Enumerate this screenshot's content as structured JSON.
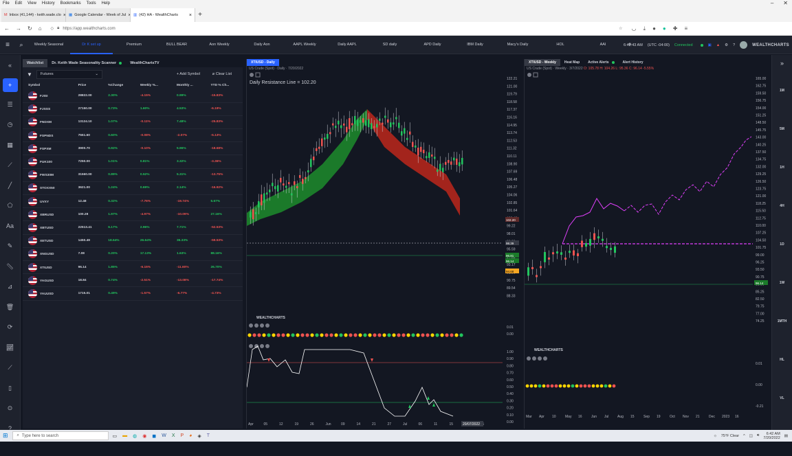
{
  "browser": {
    "menu": [
      "File",
      "Edit",
      "View",
      "History",
      "Bookmarks",
      "Tools",
      "Help"
    ],
    "tabs": [
      {
        "label": "Inbox (41,144) - keith.wade.clo",
        "active": false
      },
      {
        "label": "Google Calendar - Week of Jul",
        "active": false
      },
      {
        "label": "(42) HA - WealthCharts",
        "active": true
      }
    ],
    "url": "https://app.wealthcharts.com"
  },
  "app": {
    "tabs": [
      "Weekly Seasonal",
      "Dr K set up",
      "Premium",
      "BULL BEAR",
      "Aon Weekly",
      "Daily Aon",
      "AAPL Weekly",
      "Daily AAPL",
      "SD daily",
      "APD Daily",
      "IBM Daily",
      "Macy's Daily",
      "HOL",
      "AAI"
    ],
    "active_tab": "Dr K set up",
    "time": "6:42:43 AM",
    "tz": "(UTC -04:00)",
    "status": "Connected",
    "brand": "WEALTHCHARTS"
  },
  "watchlist": {
    "tabs": [
      "Watchlist",
      "Dr. Keith Wade Seasonality Scanner",
      "WealthChartsTV"
    ],
    "filter": "Futures",
    "add_label": "+ Add Symbol",
    "clear_label": "Clear List",
    "columns": [
      "Symbol",
      "Price",
      "%Change",
      "Weekly %...",
      "Monthly ...",
      "YTD % Ch..."
    ],
    "rows": [
      {
        "symbol": "FJISI",
        "price": "28822.00",
        "chg": "2.30%",
        "wk": "-4.15%",
        "mo": "0.99%",
        "ytd": "-15.83%",
        "s": [
          1,
          -1,
          1,
          -1
        ]
      },
      {
        "symbol": "FJSSS",
        "price": "27150.00",
        "chg": "0.73%",
        "wk": "1.60%",
        "mo": "4.53%",
        "ytd": "-6.19%",
        "s": [
          1,
          1,
          1,
          -1
        ]
      },
      {
        "symbol": "FNDXM",
        "price": "13124.10",
        "chg": "1.07%",
        "wk": "-0.11%",
        "mo": "7.48%",
        "ytd": "-25.83%",
        "s": [
          1,
          -1,
          1,
          -1
        ]
      },
      {
        "symbol": "FSPNDS",
        "price": "7551.60",
        "chg": "0.60%",
        "wk": "-0.08%",
        "mo": "-2.07%",
        "ytd": "-5.13%",
        "s": [
          1,
          -1,
          -1,
          -1
        ]
      },
      {
        "symbol": "FSPXM",
        "price": "3900.70",
        "chg": "0.92%",
        "wk": "-0.10%",
        "mo": "5.96%",
        "ytd": "-18.68%",
        "s": [
          1,
          -1,
          1,
          -1
        ]
      },
      {
        "symbol": "FUK100",
        "price": "7250.00",
        "chg": "1.01%",
        "wk": "0.81%",
        "mo": "3.32%",
        "ytd": "-3.36%",
        "s": [
          1,
          1,
          1,
          -1
        ]
      },
      {
        "symbol": "FWS30M",
        "price": "31560.00",
        "chg": "0.89%",
        "wk": "0.52%",
        "mo": "5.31%",
        "ytd": "-13.75%",
        "s": [
          1,
          1,
          1,
          -1
        ]
      },
      {
        "symbol": "STOXX50",
        "price": "3621.00",
        "chg": "1.24%",
        "wk": "0.69%",
        "mo": "2.14%",
        "ytd": "-16.92%",
        "s": [
          1,
          1,
          1,
          -1
        ]
      },
      {
        "symbol": "UVXY",
        "price": "12.48",
        "chg": "0.32%",
        "wk": "-7.76%",
        "mo": "-19.74%",
        "ytd": "5.67%",
        "s": [
          1,
          -1,
          -1,
          1
        ]
      },
      {
        "symbol": "XBRUSD",
        "price": "100.28",
        "chg": "1.97%",
        "wk": "-4.97%",
        "mo": "-10.09%",
        "ytd": "27.16%",
        "s": [
          1,
          -1,
          -1,
          1
        ]
      },
      {
        "symbol": "XBTUSD",
        "price": "22513.41",
        "chg": "6.17%",
        "wk": "2.96%",
        "mo": "7.71%",
        "ytd": "-52.53%",
        "s": [
          1,
          1,
          1,
          -1
        ]
      },
      {
        "symbol": "XETUSD",
        "price": "1450.49",
        "chg": "18.64%",
        "wk": "26.64%",
        "mo": "36.33%",
        "ytd": "-59.53%",
        "s": [
          1,
          1,
          1,
          -1
        ]
      },
      {
        "symbol": "XNGUSD",
        "price": "7.08",
        "chg": "0.20%",
        "wk": "17.13%",
        "mo": "1.63%",
        "ytd": "88.16%",
        "s": [
          1,
          1,
          1,
          1
        ]
      },
      {
        "symbol": "XTIUSD",
        "price": "96.14",
        "chg": "1.85%",
        "wk": "-6.15%",
        "mo": "-11.60%",
        "ytd": "26.70%",
        "s": [
          1,
          -1,
          -1,
          1
        ]
      },
      {
        "symbol": "YAGUSD",
        "price": "18.84",
        "chg": "0.74%",
        "wk": "-2.51%",
        "mo": "-13.08%",
        "ytd": "-17.74%",
        "s": [
          1,
          -1,
          -1,
          -1
        ]
      },
      {
        "symbol": "YAUUSD",
        "price": "1715.01",
        "chg": "0.49%",
        "wk": "-1.57%",
        "mo": "-6.77%",
        "ytd": "-4.73%",
        "s": [
          1,
          -1,
          -1,
          -1
        ]
      }
    ]
  },
  "daily_chart": {
    "tab": "XTIUSD - Daily",
    "subtitle": "US Crude (Spot) · Daily · 7/20/2022",
    "annotation": "Daily Resistance Line = 102.20",
    "price_axis": [
      "122.21",
      "121.00",
      "119.79",
      "118.58",
      "117.37",
      "116.16",
      "114.95",
      "113.74",
      "112.53",
      "111.32",
      "110.11",
      "108.90",
      "107.69",
      "106.48",
      "105.27",
      "104.06",
      "102.85",
      "101.64",
      "100.43",
      "99.22",
      "98.01",
      "96.80",
      "95.59",
      "94.38",
      "93.17",
      "91.96",
      "90.75",
      "89.54",
      "88.33"
    ],
    "price_labels": [
      {
        "text": "102.20",
        "color": "#ef5350"
      },
      {
        "text": "98.39",
        "color": "#d1d4dc"
      },
      {
        "text": "96.81",
        "color": "#22c55e"
      },
      {
        "text": "96.14",
        "color": "#22c55e"
      },
      {
        "text": "94.68",
        "color": "#f5a623"
      }
    ],
    "date_axis": [
      "Apr",
      "05",
      "12",
      "19",
      "26",
      "Jun",
      "09",
      "14",
      "21",
      "27",
      "Jul",
      "06",
      "11",
      "15",
      "23",
      "25"
    ],
    "date_highlight": "20/07/2022",
    "ind1_axis": [
      "0.01",
      "0.00"
    ],
    "osc_axis": [
      "1.00",
      "0.90",
      "0.80",
      "0.70",
      "0.60",
      "0.50",
      "0.40",
      "0.30",
      "0.20",
      "0.10",
      "0.00"
    ],
    "brand": "WEALTHCHARTS"
  },
  "weekly_chart": {
    "tabs": [
      "XTIUSD - Weekly",
      "Heat Map",
      "Active Alerts",
      "Alert History"
    ],
    "subtitle": "US Crude (Spot) · Weekly · 3/7/2022",
    "ohlc": "O: 105.78 H: 104.26 L: 95.36 C: 96.14 -5.55%",
    "price_axis": [
      "165.00",
      "162.75",
      "159.50",
      "156.75",
      "154.00",
      "151.25",
      "148.50",
      "145.75",
      "143.00",
      "140.25",
      "137.50",
      "134.75",
      "132.00",
      "129.25",
      "126.50",
      "123.75",
      "121.00",
      "118.25",
      "115.50",
      "112.75",
      "110.00",
      "107.25",
      "104.50",
      "101.75",
      "99.00",
      "96.25",
      "93.50",
      "90.75",
      "88.00",
      "85.25",
      "82.50",
      "79.75",
      "77.00",
      "74.25"
    ],
    "current_label": "96.14",
    "date_axis": [
      "Mar",
      "Apr",
      "10",
      "May",
      "16",
      "Jun",
      "Jul",
      "Aug",
      "15",
      "Sep",
      "19",
      "Oct",
      "Nov",
      "21",
      "Dec",
      "2023",
      "16"
    ],
    "ind_axis": [
      "0.01",
      "0.00",
      "-0.21"
    ],
    "brand": "WEALTHCHARTS"
  },
  "right_rail": [
    "1M",
    "5M",
    "1H",
    "4H",
    "1D",
    "1W",
    "1MTH",
    "HL",
    "VL",
    "T"
  ],
  "taskbar": {
    "search": "Type here to search",
    "weather": "75°F Clear",
    "time": "6:42 AM",
    "date": "7/20/2022"
  }
}
